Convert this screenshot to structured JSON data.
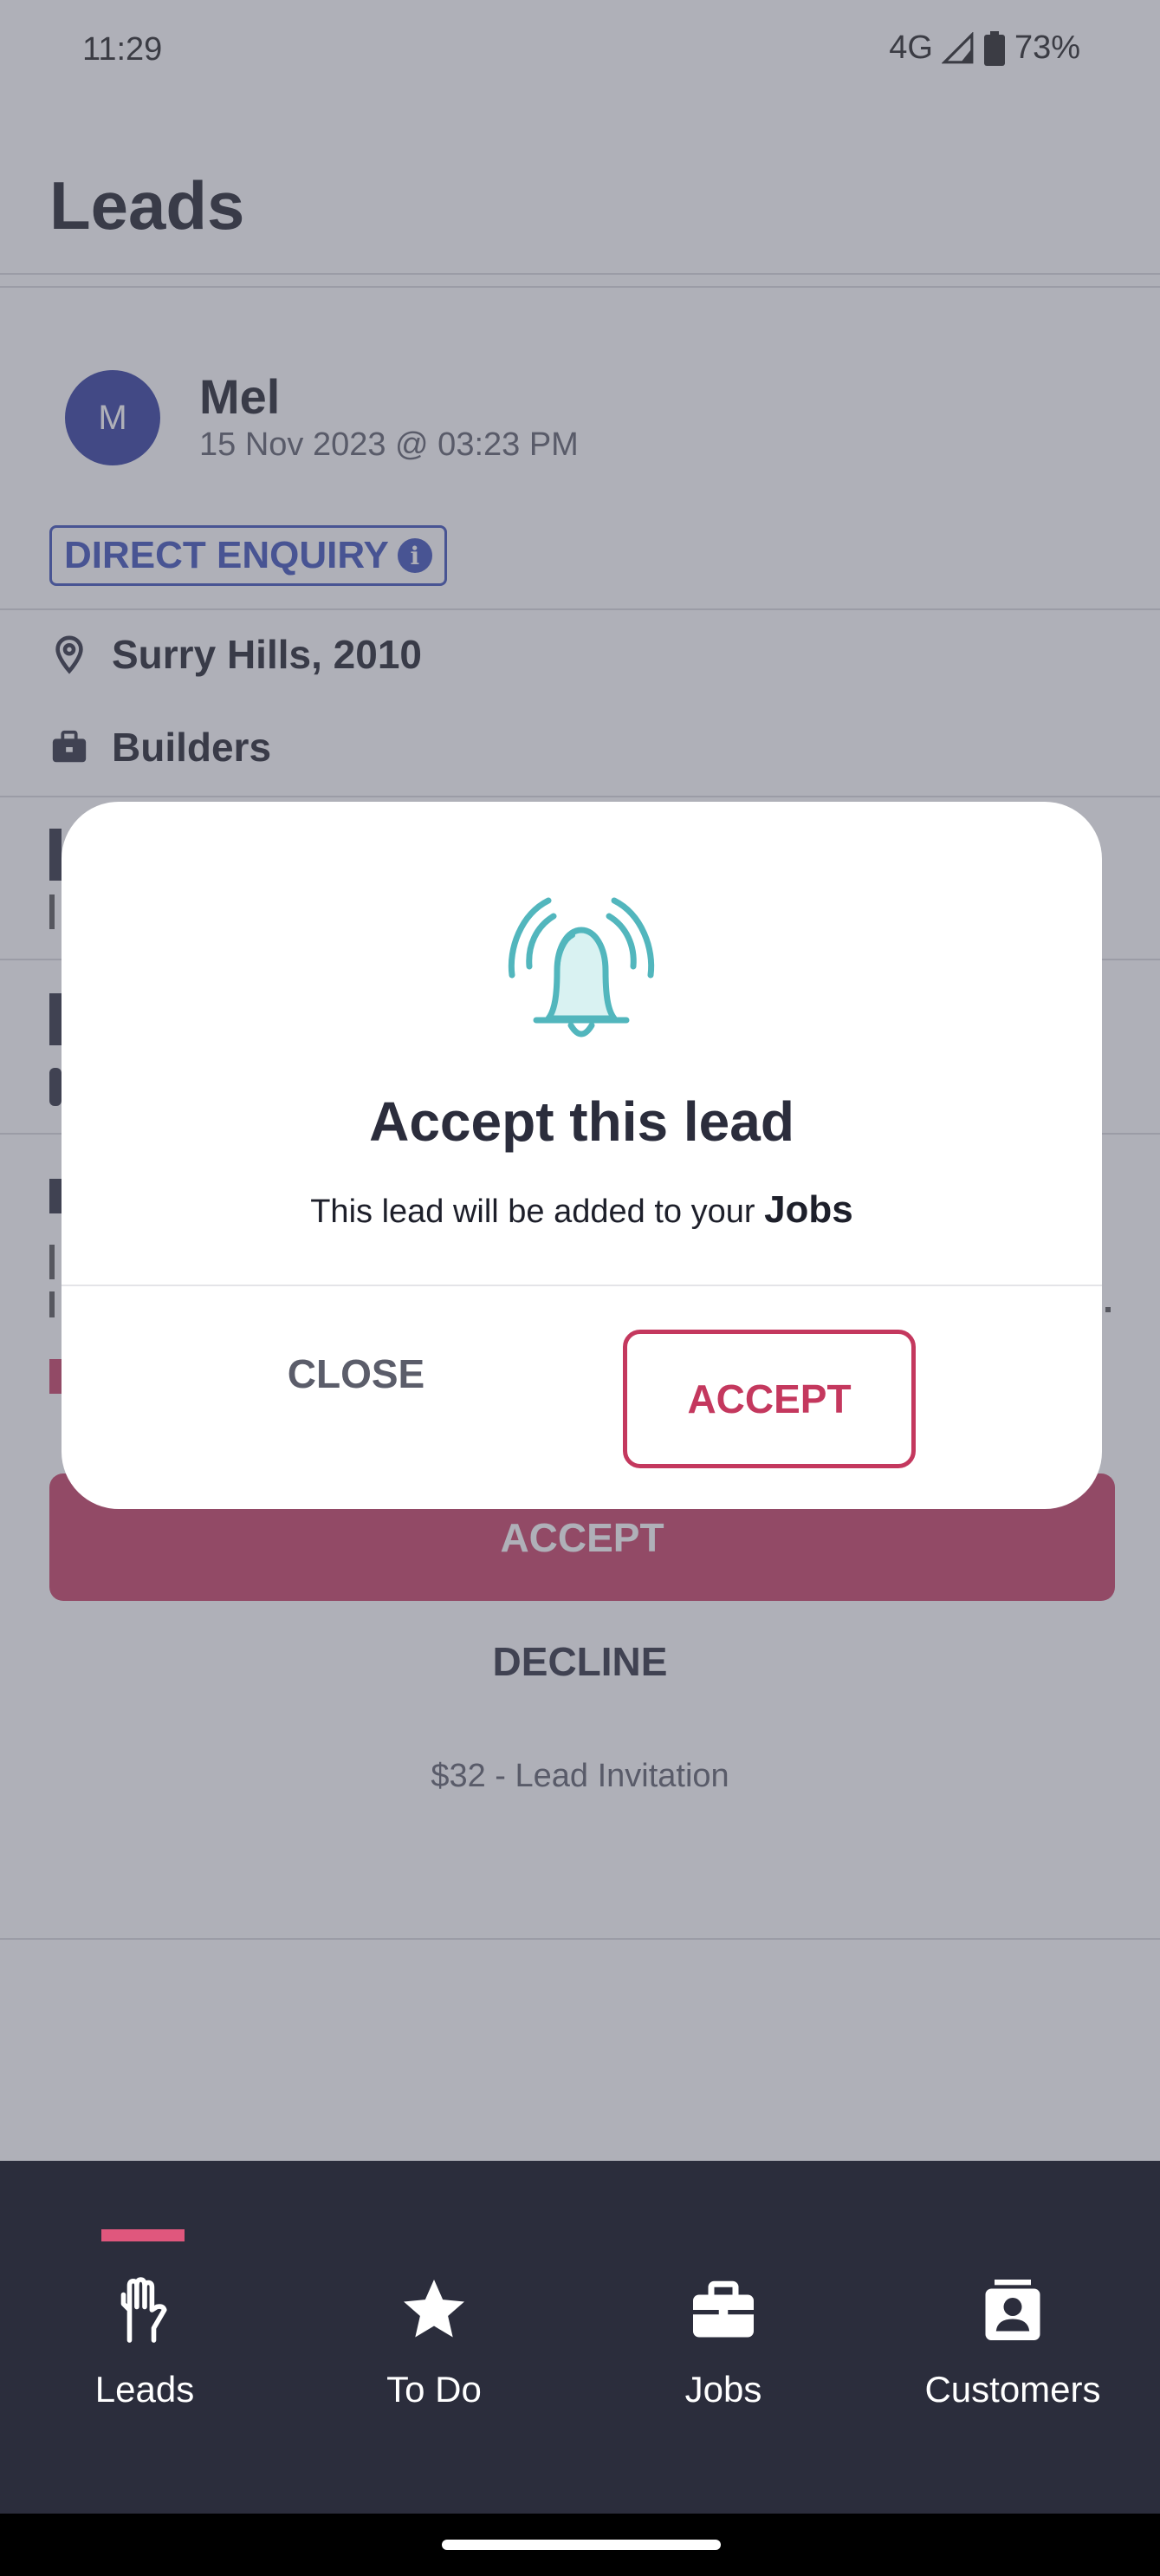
{
  "status_bar": {
    "time": "11:29",
    "network": "4G",
    "battery": "73%"
  },
  "header": {
    "title": "Leads"
  },
  "lead": {
    "avatar_initial": "M",
    "name": "Mel",
    "date": "15 Nov 2023 @ 03:23 PM",
    "badge": "DIRECT ENQUIRY",
    "location": "Surry Hills, 2010",
    "category": "Builders"
  },
  "actions": {
    "accept": "ACCEPT",
    "decline": "DECLINE",
    "price": "$32 - Lead Invitation"
  },
  "modal": {
    "title": "Accept this lead",
    "body_prefix": "This lead will be added to your ",
    "body_emphasis": "Jobs",
    "close_label": "CLOSE",
    "accept_label": "ACCEPT",
    "accent_color": "#c4385e",
    "icon": "bell-ringing-icon"
  },
  "nav": {
    "items": [
      {
        "label": "Leads",
        "icon": "hand-icon",
        "active": true
      },
      {
        "label": "To Do",
        "icon": "star-icon"
      },
      {
        "label": "Jobs",
        "icon": "briefcase-icon"
      },
      {
        "label": "Customers",
        "icon": "contact-card-icon"
      }
    ]
  }
}
